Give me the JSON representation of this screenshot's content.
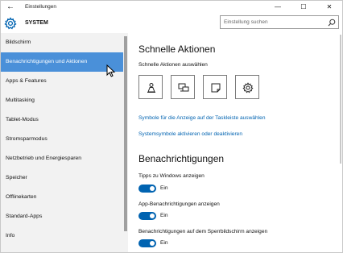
{
  "titlebar": {
    "title": "Einstellungen",
    "back_icon": "arrow-left-icon",
    "minimize_glyph": "—",
    "maximize_glyph": "☐",
    "close_glyph": "✕"
  },
  "header": {
    "app_name": "SYSTEM",
    "logo_icon": "gear-icon",
    "search_placeholder": "Einstellung suchen",
    "search_icon": "search-icon"
  },
  "sidebar": {
    "items": [
      {
        "label": "Bildschirm"
      },
      {
        "label": "Benachrichtigungen und Aktionen",
        "selected": true
      },
      {
        "label": "Apps & Features"
      },
      {
        "label": "Multitasking"
      },
      {
        "label": "Tablet-Modus"
      },
      {
        "label": "Stromsparmodus"
      },
      {
        "label": "Netzbetrieb und Energiesparen"
      },
      {
        "label": "Speicher"
      },
      {
        "label": "Offlinekarten"
      },
      {
        "label": "Standard-Apps"
      },
      {
        "label": "Info"
      }
    ]
  },
  "main": {
    "quick_actions": {
      "title": "Schnelle Aktionen",
      "select_label": "Schnelle Aktionen auswählen",
      "tiles": [
        {
          "icon": "person-icon"
        },
        {
          "icon": "project-screen-icon"
        },
        {
          "icon": "note-icon"
        },
        {
          "icon": "settings-gear-icon"
        }
      ],
      "link_taskbar": "Symbole für die Anzeige auf der Taskleiste auswählen",
      "link_system": "Systemsymbole aktivieren oder deaktivieren"
    },
    "notifications": {
      "title": "Benachrichtigungen",
      "toggles": [
        {
          "label": "Tipps zu Windows anzeigen",
          "state": "Ein"
        },
        {
          "label": "App-Benachrichtigungen anzeigen",
          "state": "Ein"
        },
        {
          "label": "Benachrichtigungen auf dem Sperrbildschirm anzeigen",
          "state": "Ein"
        }
      ]
    }
  },
  "colors": {
    "accent": "#0063b1",
    "selected_item": "#4a90d9",
    "sidebar_bg": "#f2f2f2"
  }
}
